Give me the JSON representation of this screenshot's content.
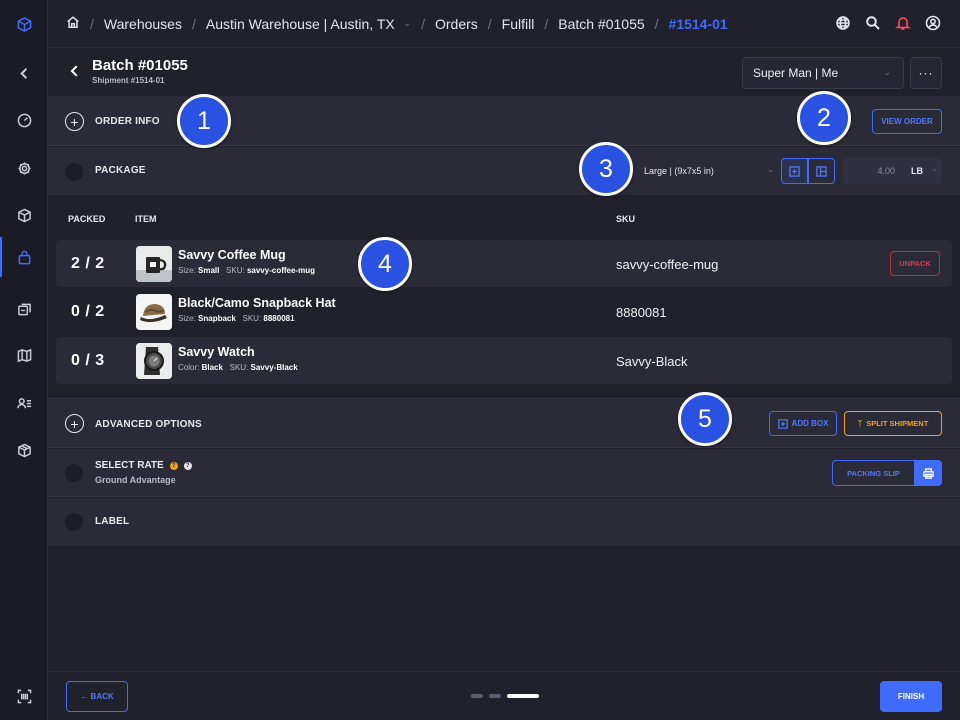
{
  "breadcrumbs": {
    "warehouses": "Warehouses",
    "warehouse": "Austin Warehouse | Austin, TX",
    "orders": "Orders",
    "fulfill": "Fulfill",
    "batch": "Batch #01055",
    "current": "#1514-01"
  },
  "header": {
    "title": "Batch #01055",
    "subtitle": "Shipment #1514-01",
    "user": "Super Man | Me",
    "more_label": "···"
  },
  "order_info": {
    "label": "ORDER INFO",
    "view_order": "VIEW ORDER"
  },
  "package": {
    "label": "PACKAGE",
    "size": "Large | (9x7x5 in)",
    "weight_placeholder": "4.00",
    "unit": "LB"
  },
  "table": {
    "headers": {
      "packed": "PACKED",
      "item": "ITEM",
      "sku": "SKU"
    },
    "rows": [
      {
        "packed": "2 / 2",
        "name": "Savvy Coffee Mug",
        "attr_label": "Size:",
        "attr_value": "Small",
        "sku_label": "SKU:",
        "sku_value": "savvy-coffee-mug",
        "sku": "savvy-coffee-mug",
        "action": "UNPACK"
      },
      {
        "packed": "0 / 2",
        "name": "Black/Camo Snapback Hat",
        "attr_label": "Size:",
        "attr_value": "Snapback",
        "sku_label": "SKU:",
        "sku_value": "8880081",
        "sku": "8880081"
      },
      {
        "packed": "0 / 3",
        "name": "Savvy Watch",
        "attr_label": "Color:",
        "attr_value": "Black",
        "sku_label": "SKU:",
        "sku_value": "Savvy-Black",
        "sku": "Savvy-Black"
      }
    ]
  },
  "advanced": {
    "label": "ADVANCED OPTIONS",
    "add_box": "ADD BOX",
    "split": "SPLIT SHIPMENT"
  },
  "rate": {
    "label": "SELECT RATE",
    "value": "Ground Advantage",
    "packing_slip": "PACKING SLIP"
  },
  "label_section": {
    "label": "LABEL"
  },
  "footer": {
    "back": "← BACK",
    "finish": "FINISH"
  },
  "markers": [
    "1",
    "2",
    "3",
    "4",
    "5"
  ],
  "colors": {
    "accent": "#3f6bff",
    "warning": "#f0a11f",
    "danger": "#d2404d",
    "marker": "#2952e3"
  }
}
